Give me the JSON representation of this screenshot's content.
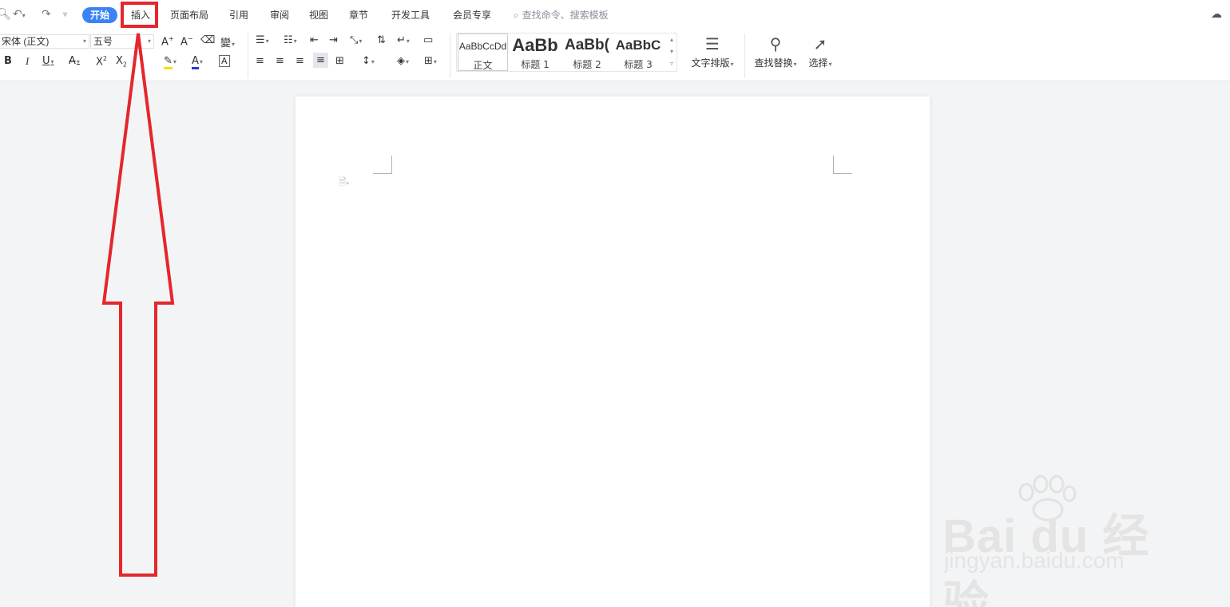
{
  "quick_access": {
    "search_icon": "search-icon",
    "undo_icon": "undo-icon",
    "redo_icon": "redo-icon",
    "customize_icon": "chevron-down-icon"
  },
  "tabs": {
    "home": "开始",
    "insert": "插入",
    "page_layout": "页面布局",
    "references": "引用",
    "review": "审阅",
    "view": "视图",
    "chapter": "章节",
    "developer": "开发工具",
    "member": "会员专享"
  },
  "search": {
    "placeholder": "查找命令、搜索模板"
  },
  "font": {
    "family": "宋体 (正文)",
    "size": "五号"
  },
  "format_buttons": {
    "grow_font": "A",
    "shrink_font": "A",
    "bold": "B",
    "italic": "I",
    "underline": "U",
    "strikethrough": "A",
    "superscript": "X",
    "subscript": "X",
    "font_color": "A",
    "char_border": "A"
  },
  "styles": [
    {
      "sample": "AaBbCcDd",
      "name": "正文"
    },
    {
      "sample": "AaBb",
      "name": "标题 1"
    },
    {
      "sample": "AaBb(",
      "name": "标题 2"
    },
    {
      "sample": "AaBbC",
      "name": "标题 3"
    }
  ],
  "big_buttons": {
    "text_layout": "文字排版",
    "find_replace": "查找替换",
    "select": "选择"
  },
  "watermark": {
    "brand": "Bai du 经验",
    "url": "jingyan.baidu.com"
  },
  "colors": {
    "active_tab": "#3b82f6",
    "annotation_red": "#e5262d",
    "highlight_yellow": "#f5e100",
    "font_color_red": "#1f3fd6"
  }
}
